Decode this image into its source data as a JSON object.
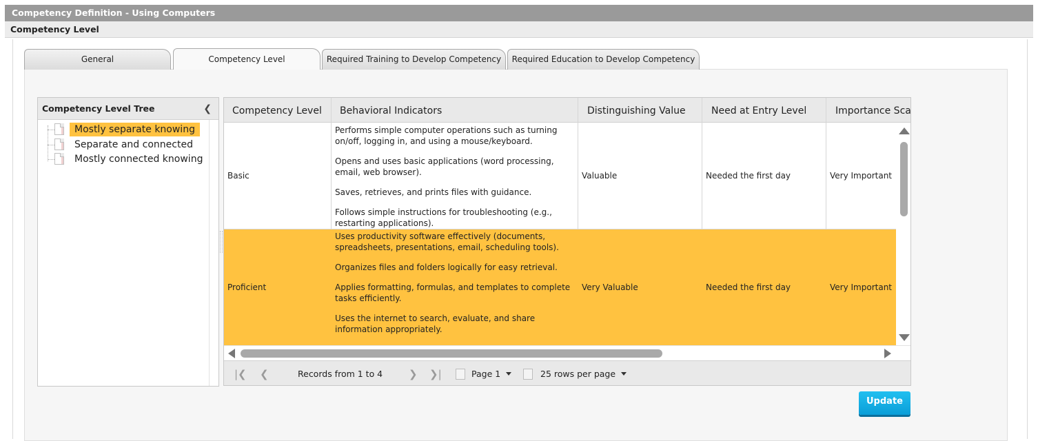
{
  "window": {
    "title": "Competency Definition - Using Computers",
    "subtitle": "Competency Level"
  },
  "tabs": [
    {
      "label": "General",
      "active": false
    },
    {
      "label": "Competency Level",
      "active": true
    },
    {
      "label": "Required Training to Develop Competency",
      "active": false
    },
    {
      "label": "Required Education to Develop Competency",
      "active": false
    }
  ],
  "tree": {
    "title": "Competency Level Tree",
    "collapse_icon": "chevron-left-icon",
    "items": [
      {
        "label": "Mostly separate knowing",
        "selected": true
      },
      {
        "label": "Separate and connected",
        "selected": false
      },
      {
        "label": "Mostly connected knowing",
        "selected": false
      }
    ]
  },
  "grid": {
    "columns": [
      "Competency Level",
      "Behavioral Indicators",
      "Distinguishing Value",
      "Need at Entry Level",
      "Importance Scale"
    ],
    "rows": [
      {
        "level": "Basic",
        "indicators": [
          "Performs simple computer operations such as turning on/off, logging in, and using a mouse/keyboard.",
          "Opens and uses basic applications (word processing, email, web browser).",
          "Saves, retrieves, and prints files with guidance.",
          "Follows simple instructions for troubleshooting (e.g., restarting applications)."
        ],
        "distinguishing_value": "Valuable",
        "need_at_entry": "Needed the first day",
        "importance": "Very Important",
        "selected": false
      },
      {
        "level": "Proficient",
        "indicators": [
          "Uses productivity software effectively (documents, spreadsheets, presentations, email, scheduling tools).",
          "Organizes files and folders logically for easy retrieval.",
          "Applies formatting, formulas, and templates to complete tasks efficiently.",
          "Uses the internet to search, evaluate, and share information appropriately."
        ],
        "distinguishing_value": "Very Valuable",
        "need_at_entry": "Needed the first day",
        "importance": "Very Important",
        "selected": true
      }
    ],
    "highlight_color": "#ffc240"
  },
  "pager": {
    "records": "Records from 1 to 4",
    "page": "Page 1",
    "rows_per_page": "25 rows per page"
  },
  "actions": {
    "update_label": "Update",
    "accent": "#12acdf"
  }
}
